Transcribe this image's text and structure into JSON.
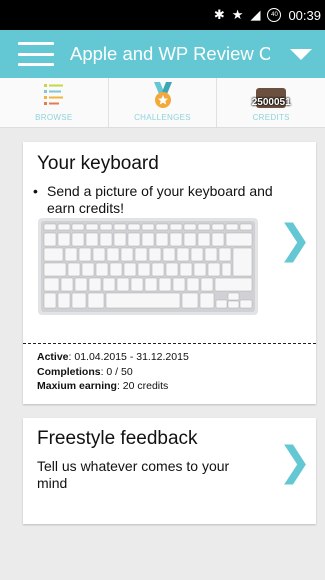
{
  "status_bar": {
    "time": "00:39",
    "battery": "40"
  },
  "app_bar": {
    "title": "Apple and WP Review Ca..."
  },
  "tabs": [
    {
      "label": "BROWSE",
      "icon": "list-icon"
    },
    {
      "label": "CHALLENGES",
      "icon": "medal-icon"
    },
    {
      "label": "CREDITS",
      "icon": "wallet-icon",
      "amount": "2500051"
    }
  ],
  "cards": [
    {
      "title": "Your keyboard",
      "bullet": "Send a picture of your keyboard and earn credits!",
      "active_label": "Active",
      "active_value": ": 01.04.2015 - 31.12.2015",
      "completions_label": "Completions",
      "completions_value": ": 0 / 50",
      "earning_label": "Maxium earning",
      "earning_value": ": 20 credits"
    },
    {
      "title": "Freestyle feedback",
      "description": "Tell us whatever comes to your mind"
    }
  ],
  "colors": {
    "accent": "#63c8d3",
    "background": "#ebebeb"
  }
}
